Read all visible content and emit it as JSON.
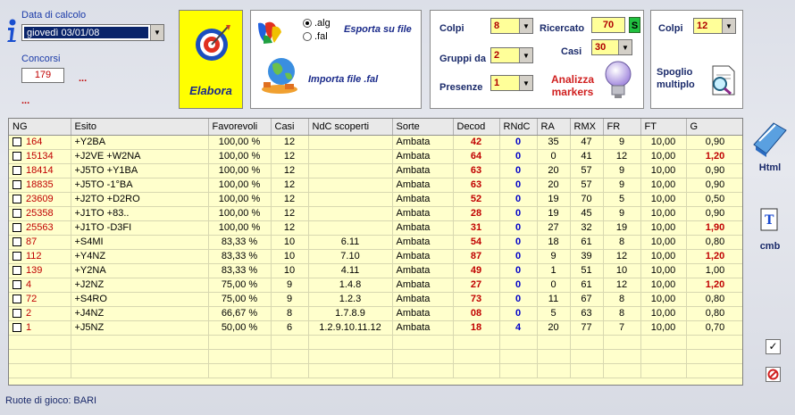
{
  "top": {
    "data_label": "Data di calcolo",
    "data_value": "giovedì 03/01/08",
    "concorsi_label": "Concorsi",
    "concorsi_value": "179",
    "dots1": "...",
    "dots2": "..."
  },
  "elabora": {
    "label": "Elabora"
  },
  "file_panel": {
    "radio_alg": ".alg",
    "radio_fal": ".fal",
    "esporta": "Esporta su file",
    "importa": "Importa file .fal"
  },
  "params": {
    "colpi_label": "Colpi",
    "colpi_value": "8",
    "gruppi_label": "Gruppi da",
    "gruppi_value": "2",
    "presenze_label": "Presenze",
    "presenze_value": "1",
    "ricercato_label": "Ricercato",
    "ricercato_value": "70",
    "ricercato_btn": "S",
    "casi_label": "Casi",
    "casi_value": "30",
    "analizza": "Analizza markers"
  },
  "spoglio": {
    "colpi_label": "Colpi",
    "colpi_value": "12",
    "label": "Spoglio multiplo"
  },
  "side": {
    "html": "Html",
    "cmb": "cmb"
  },
  "table": {
    "headers": [
      "NG",
      "Esito",
      "Favorevoli",
      "Casi",
      "NdC scoperti",
      "Sorte",
      "Decod",
      "RNdC",
      "RA",
      "RMX",
      "FR",
      "FT",
      "G"
    ],
    "rows": [
      [
        "164",
        "+Y2BA",
        "100,00 %",
        "12",
        "",
        "Ambata",
        "42",
        "0",
        "35",
        "47",
        "9",
        "10,00",
        "0,90"
      ],
      [
        "15134",
        "+J2VE +W2NA",
        "100,00 %",
        "12",
        "",
        "Ambata",
        "64",
        "0",
        "0",
        "41",
        "12",
        "10,00",
        "1,20"
      ],
      [
        "18414",
        "+J5TO +Y1BA",
        "100,00 %",
        "12",
        "",
        "Ambata",
        "63",
        "0",
        "20",
        "57",
        "9",
        "10,00",
        "0,90"
      ],
      [
        "18835",
        "+J5TO -1°BA",
        "100,00 %",
        "12",
        "",
        "Ambata",
        "63",
        "0",
        "20",
        "57",
        "9",
        "10,00",
        "0,90"
      ],
      [
        "23609",
        "+J2TO +D2RO",
        "100,00 %",
        "12",
        "",
        "Ambata",
        "52",
        "0",
        "19",
        "70",
        "5",
        "10,00",
        "0,50"
      ],
      [
        "25358",
        "+J1TO +83..",
        "100,00 %",
        "12",
        "",
        "Ambata",
        "28",
        "0",
        "19",
        "45",
        "9",
        "10,00",
        "0,90"
      ],
      [
        "25563",
        "+J1TO -D3FI",
        "100,00 %",
        "12",
        "",
        "Ambata",
        "31",
        "0",
        "27",
        "32",
        "19",
        "10,00",
        "1,90"
      ],
      [
        "87",
        "+S4MI",
        "83,33 %",
        "10",
        "6.11",
        "Ambata",
        "54",
        "0",
        "18",
        "61",
        "8",
        "10,00",
        "0,80"
      ],
      [
        "112",
        "+Y4NZ",
        "83,33 %",
        "10",
        "7.10",
        "Ambata",
        "87",
        "0",
        "9",
        "39",
        "12",
        "10,00",
        "1,20"
      ],
      [
        "139",
        "+Y2NA",
        "83,33 %",
        "10",
        "4.11",
        "Ambata",
        "49",
        "0",
        "1",
        "51",
        "10",
        "10,00",
        "1,00"
      ],
      [
        "4",
        "+J2NZ",
        "75,00 %",
        "9",
        "1.4.8",
        "Ambata",
        "27",
        "0",
        "0",
        "61",
        "12",
        "10,00",
        "1,20"
      ],
      [
        "72",
        "+S4RO",
        "75,00 %",
        "9",
        "1.2.3",
        "Ambata",
        "73",
        "0",
        "11",
        "67",
        "8",
        "10,00",
        "0,80"
      ],
      [
        "2",
        "+J4NZ",
        "66,67 %",
        "8",
        "1.7.8.9",
        "Ambata",
        "08",
        "0",
        "5",
        "63",
        "8",
        "10,00",
        "0,80"
      ],
      [
        "1",
        "+J5NZ",
        "50,00 %",
        "6",
        "1.2.9.10.11.12",
        "Ambata",
        "18",
        "4",
        "20",
        "77",
        "7",
        "10,00",
        "0,70"
      ]
    ]
  },
  "status": {
    "ruote": "Ruote di gioco: BARI"
  },
  "colors": {
    "red": "#c00000",
    "blue": "#0000c8",
    "yellow": "#ffff00",
    "row": "#ffffcc"
  }
}
